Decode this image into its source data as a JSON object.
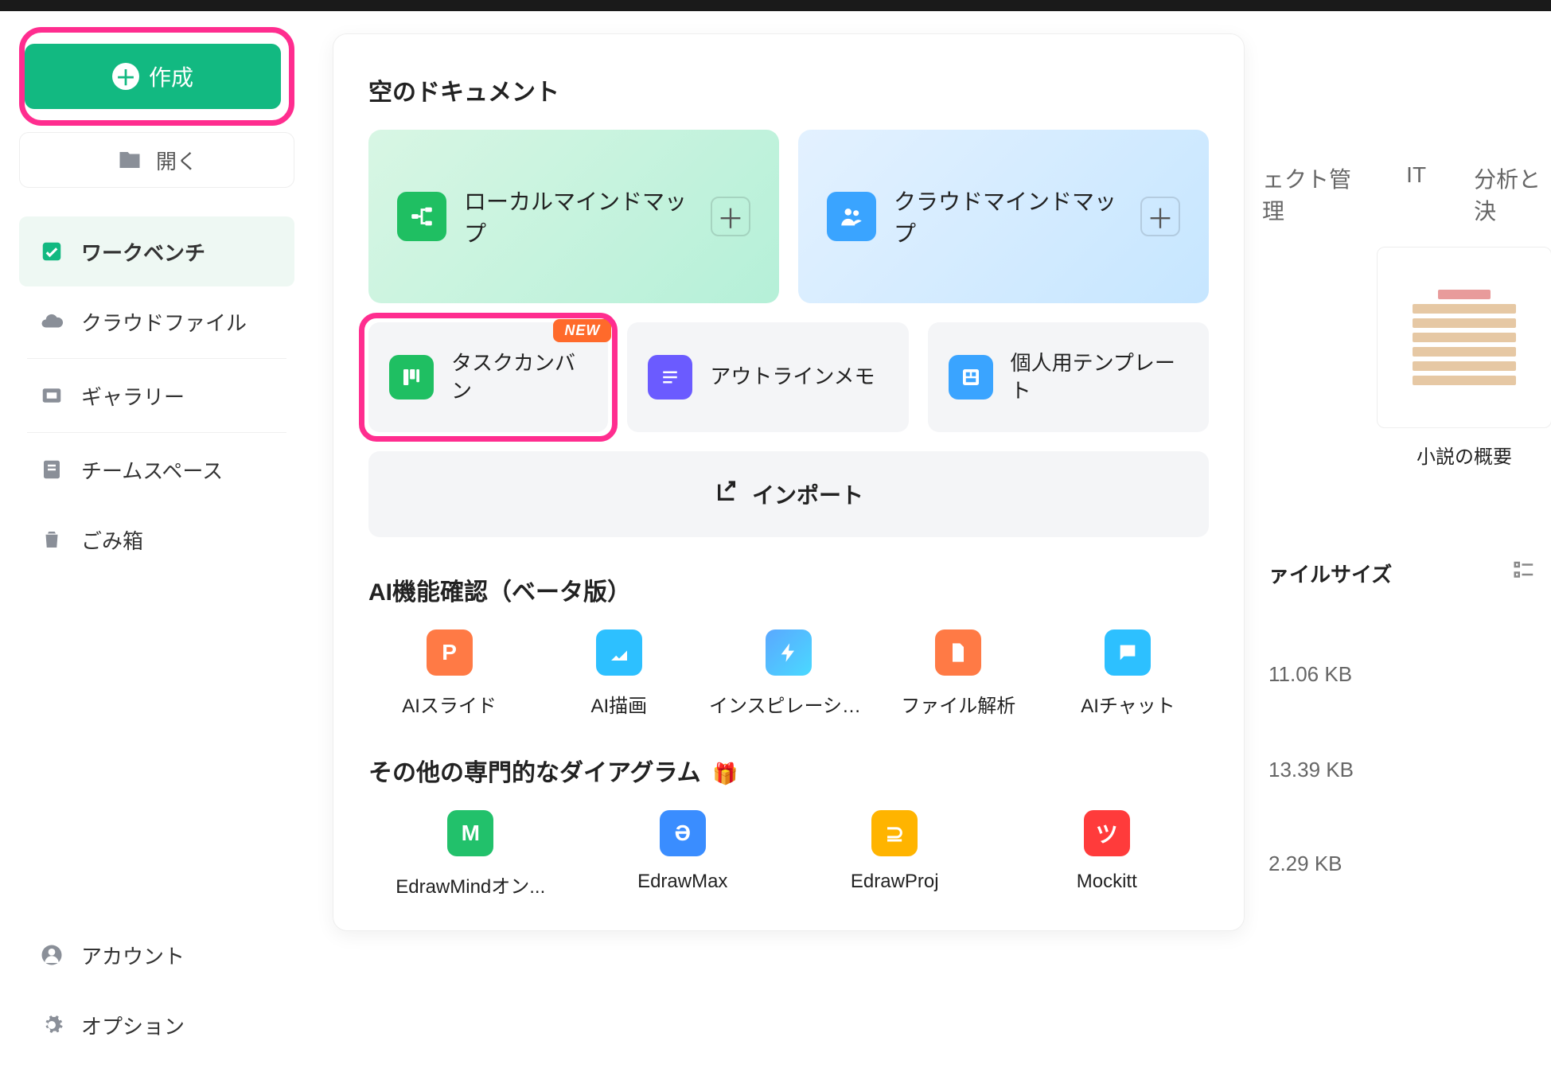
{
  "sidebar": {
    "create": "作成",
    "open": "開く",
    "items": [
      {
        "label": "ワークベンチ",
        "icon": "workbench-icon"
      },
      {
        "label": "クラウドファイル",
        "icon": "cloud-icon"
      },
      {
        "label": "ギャラリー",
        "icon": "gallery-icon"
      },
      {
        "label": "チームスペース",
        "icon": "team-icon"
      },
      {
        "label": "ごみ箱",
        "icon": "trash-icon"
      }
    ],
    "account": "アカウント",
    "options": "オプション"
  },
  "main": {
    "empty_title": "空のドキュメント",
    "local_mindmap": "ローカルマインドマップ",
    "cloud_mindmap": "クラウドマインドマップ",
    "task_kanban": "タスクカンバン",
    "new_badge": "NEW",
    "outline_memo": "アウトラインメモ",
    "personal_template": "個人用テンプレート",
    "import": "インポート",
    "ai_title": "AI機能確認（ベータ版）",
    "ai_items": [
      "AIスライド",
      "AI描画",
      "インスピレーション...",
      "ファイル解析",
      "AIチャット"
    ],
    "diag_title": "その他の専門的なダイアグラム",
    "diag_items": [
      "EdrawMindオン...",
      "EdrawMax",
      "EdrawProj",
      "Mockitt"
    ]
  },
  "right": {
    "tabs": [
      "ェクト管理",
      "IT",
      "分析と決"
    ],
    "template_name": "小説の概要",
    "filesize_label": "ァイルサイズ",
    "sizes": [
      "11.06 KB",
      "13.39 KB",
      "2.29 KB"
    ]
  }
}
